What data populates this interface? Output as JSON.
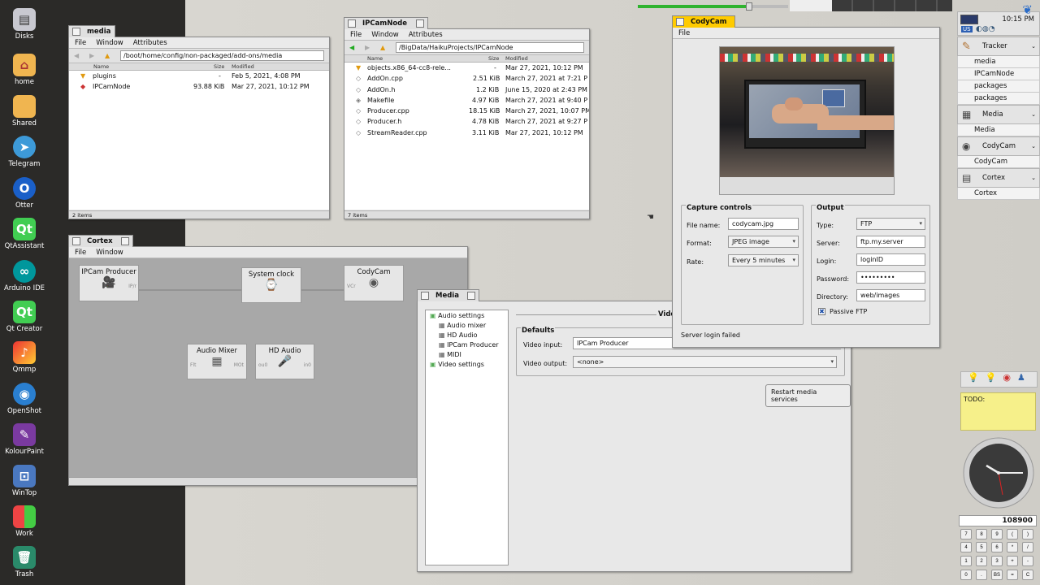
{
  "desktop": {
    "items": [
      "Disks",
      "home",
      "Shared",
      "Telegram",
      "Otter",
      "QtAssistant",
      "Arduino IDE",
      "Qt Creator",
      "Qmmp",
      "OpenShot",
      "KolourPaint",
      "WinTop",
      "Work",
      "Trash"
    ]
  },
  "media_win": {
    "title": "media",
    "menu": [
      "File",
      "Window",
      "Attributes"
    ],
    "path": "/boot/home/config/non-packaged/add-ons/media",
    "cols": {
      "name": "Name",
      "size": "Size",
      "modified": "Modified"
    },
    "rows": [
      {
        "name": "plugins",
        "size": "-",
        "modified": "Feb 5, 2021, 4:08 PM"
      },
      {
        "name": "IPCamNode",
        "size": "93.88 KiB",
        "modified": "Mar 27, 2021, 10:12 PM"
      }
    ],
    "status": "2 items"
  },
  "ipcam_win": {
    "title": "IPCamNode",
    "menu": [
      "File",
      "Window",
      "Attributes"
    ],
    "path": "/BigData/HaikuProjects/IPCamNode",
    "cols": {
      "name": "Name",
      "size": "Size",
      "modified": "Modified"
    },
    "rows": [
      {
        "name": "objects.x86_64-cc8-rele...",
        "size": "-",
        "modified": "Mar 27, 2021, 10:12 PM"
      },
      {
        "name": "AddOn.cpp",
        "size": "2.51 KiB",
        "modified": "March 27, 2021 at 7:21 P"
      },
      {
        "name": "AddOn.h",
        "size": "1.2 KiB",
        "modified": "June 15, 2020 at 2:43 PM"
      },
      {
        "name": "Makefile",
        "size": "4.97 KiB",
        "modified": "March 27, 2021 at 9:40 P"
      },
      {
        "name": "Producer.cpp",
        "size": "18.15 KiB",
        "modified": "March 27, 2021, 10:07 PM"
      },
      {
        "name": "Producer.h",
        "size": "4.78 KiB",
        "modified": "March 27, 2021 at 9:27 P"
      },
      {
        "name": "StreamReader.cpp",
        "size": "3.11 KiB",
        "modified": "Mar 27, 2021, 10:12 PM"
      }
    ],
    "status": "7 items"
  },
  "cortex": {
    "title": "Cortex",
    "menu": [
      "File",
      "Window"
    ],
    "nodes": {
      "ipcam": "IPCam Producer",
      "clock": "System clock",
      "cody": "CodyCam",
      "mixer": "Audio Mixer",
      "hd": "HD Audio"
    },
    "ports": {
      "ipcam_out": "IP/r",
      "cody_in": "VCr",
      "mixer_in": "Flt",
      "mixer_out": "MOt",
      "hd_in": "ou0",
      "hd_out": "in0"
    }
  },
  "media_prefs": {
    "title": "Media",
    "tree": [
      "Audio settings",
      "Audio mixer",
      "HD Audio",
      "IPCam Producer",
      "MIDI",
      "Video settings"
    ],
    "header": "Video",
    "group": "Defaults",
    "video_input_label": "Video input:",
    "video_input": "IPCam Producer",
    "video_output_label": "Video output:",
    "video_output": "<none>",
    "restart": "Restart media services"
  },
  "codycam": {
    "title": "CodyCam",
    "menu": "File",
    "capture": {
      "legend": "Capture controls",
      "file_label": "File name:",
      "file": "codycam.jpg",
      "format_label": "Format:",
      "format": "JPEG image",
      "rate_label": "Rate:",
      "rate": "Every 5 minutes"
    },
    "output": {
      "legend": "Output",
      "type_label": "Type:",
      "type": "FTP",
      "server_label": "Server:",
      "server": "ftp.my.server",
      "login_label": "Login:",
      "login": "loginID",
      "password_label": "Password:",
      "password": "•••••••••",
      "dir_label": "Directory:",
      "dir": "web/images",
      "passive": "Passive FTP"
    },
    "status": "Server login failed"
  },
  "deskbar": {
    "clock": "10:15 PM",
    "kbd": "US",
    "tracker": "Tracker",
    "groups": [
      {
        "name": "Tracker",
        "items": [
          "media",
          "IPCamNode",
          "packages",
          "packages"
        ]
      },
      {
        "name": "Media",
        "items": [
          "Media"
        ]
      },
      {
        "name": "CodyCam",
        "items": [
          "CodyCam"
        ]
      },
      {
        "name": "Cortex",
        "items": [
          "Cortex"
        ]
      }
    ]
  },
  "todo": "TODO:",
  "calc": {
    "display": "108900",
    "keys": [
      "7",
      "8",
      "9",
      "(",
      ")",
      "4",
      "5",
      "6",
      "*",
      "/",
      "1",
      "2",
      "3",
      "+",
      "-",
      "0",
      ".",
      "BS",
      "=",
      "C"
    ]
  }
}
